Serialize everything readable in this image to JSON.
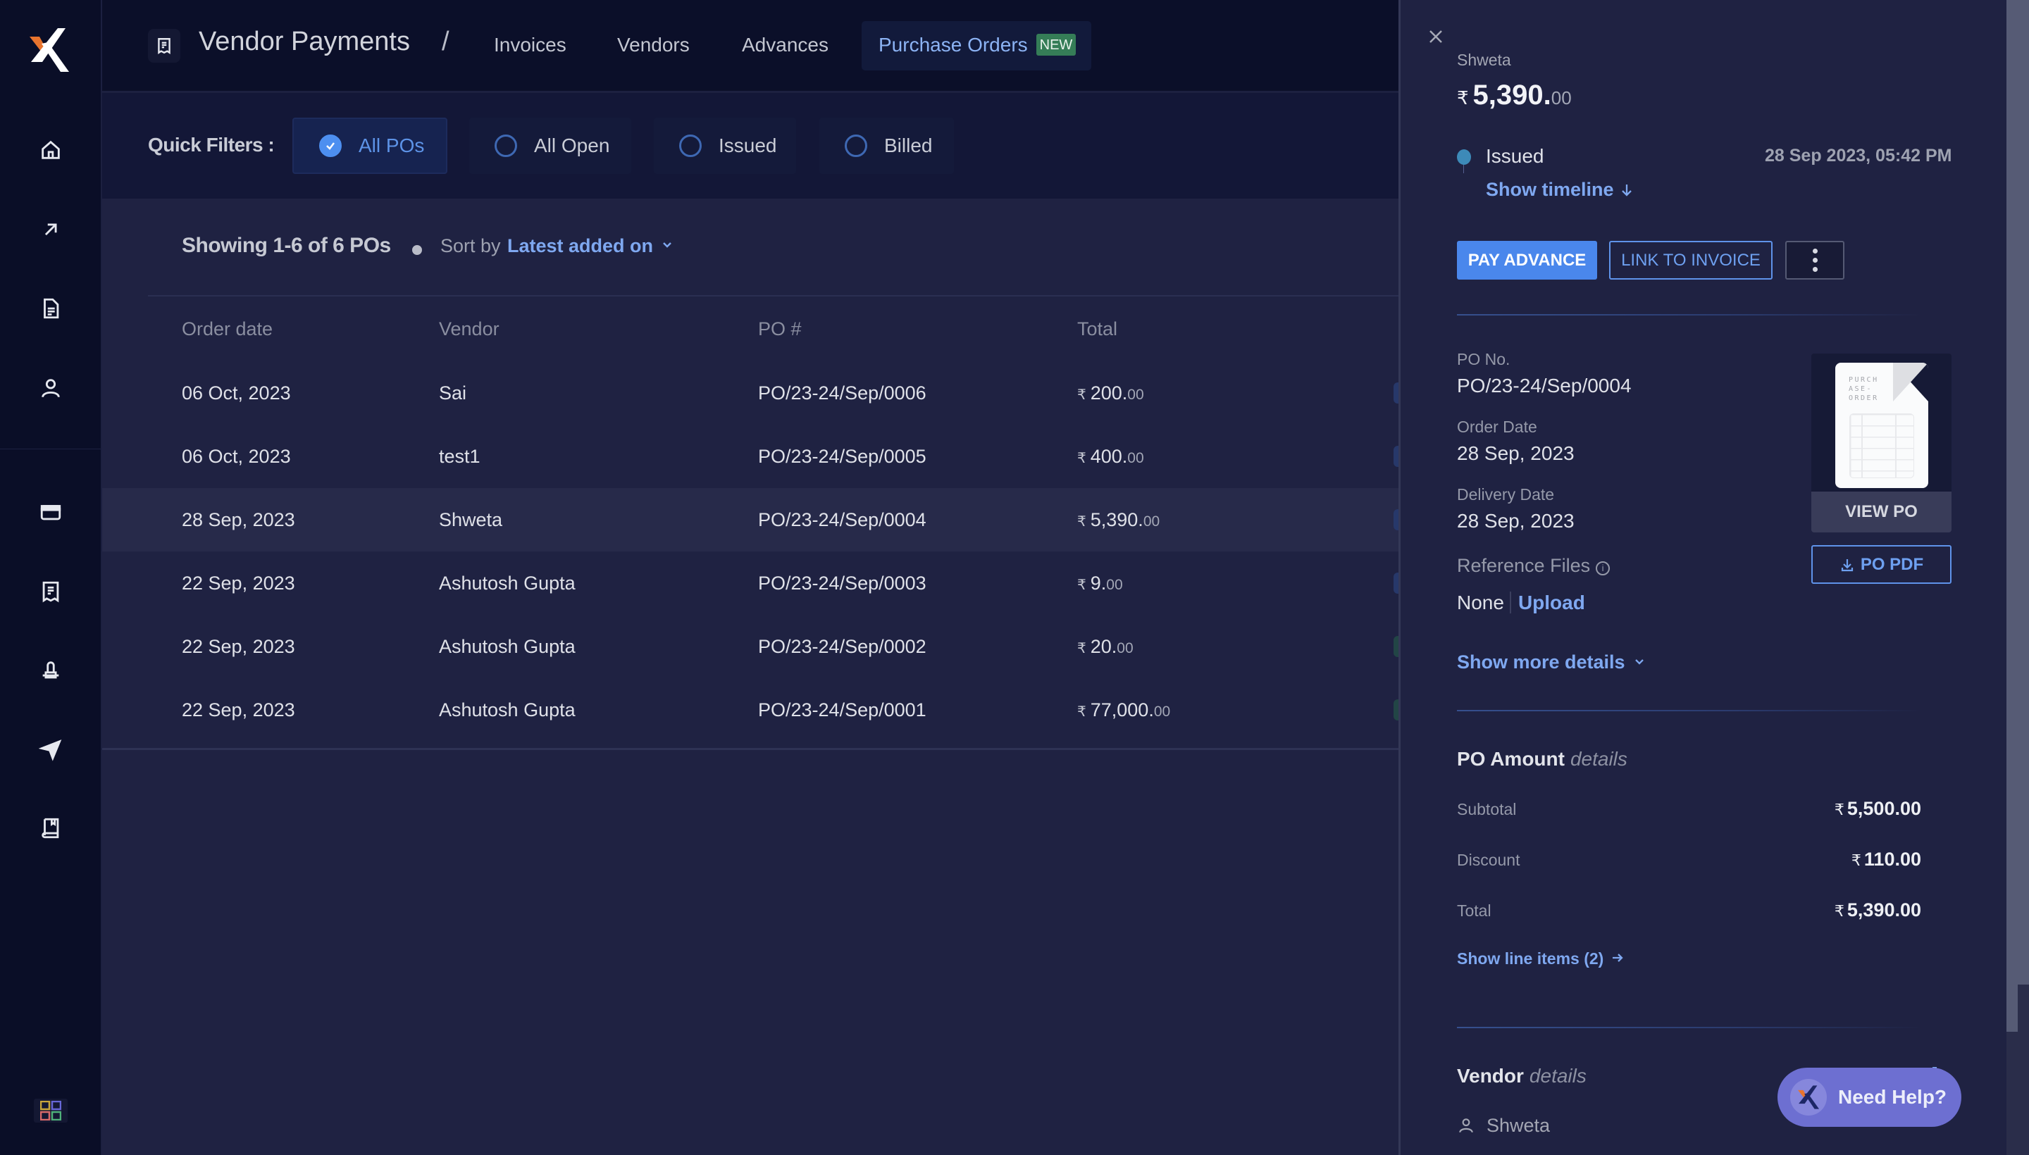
{
  "app": {
    "title": "Vendor Payments",
    "breadcrumb_separator": "/",
    "brand_colors": {
      "accent": "#4a87ec",
      "link": "#7fa8f0",
      "new_badge": "#357d57",
      "logo_orange": "#e8742e",
      "help": "#6d6fd1"
    }
  },
  "sidebar": {
    "logo": "x-logo",
    "items": [
      {
        "icon": "home-icon",
        "label": "Home"
      },
      {
        "icon": "arrow-up-right-icon",
        "label": "Payments"
      },
      {
        "icon": "document-icon",
        "label": "Documents"
      },
      {
        "icon": "user-icon",
        "label": "Contacts"
      },
      {
        "icon": "credit-card-icon",
        "label": "Cards"
      },
      {
        "icon": "receipt-icon",
        "label": "Vendor Payments"
      },
      {
        "icon": "stamp-icon",
        "label": "Approvals"
      },
      {
        "icon": "send-icon",
        "label": "Transfers"
      },
      {
        "icon": "book-icon",
        "label": "Ledger"
      }
    ],
    "apps_icon": "apps-grid-icon"
  },
  "nav": {
    "tabs": [
      {
        "label": "Invoices",
        "active": false
      },
      {
        "label": "Vendors",
        "active": false
      },
      {
        "label": "Advances",
        "active": false
      },
      {
        "label": "Purchase Orders",
        "active": true,
        "badge": "NEW"
      }
    ]
  },
  "filters": {
    "label": "Quick Filters :",
    "options": [
      {
        "label": "All POs",
        "selected": true
      },
      {
        "label": "All Open",
        "selected": false
      },
      {
        "label": "Issued",
        "selected": false
      },
      {
        "label": "Billed",
        "selected": false
      }
    ]
  },
  "list": {
    "summary": "Showing 1-6 of 6 POs",
    "sort_label": "Sort by",
    "sort_value": "Latest added on",
    "columns": [
      "Order date",
      "Vendor",
      "PO #",
      "Total"
    ],
    "currency": "₹",
    "rows": [
      {
        "date": "06 Oct, 2023",
        "vendor": "Sai",
        "po": "PO/23-24/Sep/0006",
        "total": "200.",
        "cents": "00",
        "selected": false
      },
      {
        "date": "06 Oct, 2023",
        "vendor": "test1",
        "po": "PO/23-24/Sep/0005",
        "total": "400.",
        "cents": "00",
        "selected": false
      },
      {
        "date": "28 Sep, 2023",
        "vendor": "Shweta",
        "po": "PO/23-24/Sep/0004",
        "total": "5,390.",
        "cents": "00",
        "selected": true
      },
      {
        "date": "22 Sep, 2023",
        "vendor": "Ashutosh Gupta",
        "po": "PO/23-24/Sep/0003",
        "total": "9.",
        "cents": "00",
        "selected": false
      },
      {
        "date": "22 Sep, 2023",
        "vendor": "Ashutosh Gupta",
        "po": "PO/23-24/Sep/0002",
        "total": "20.",
        "cents": "00",
        "selected": false
      },
      {
        "date": "22 Sep, 2023",
        "vendor": "Ashutosh Gupta",
        "po": "PO/23-24/Sep/0001",
        "total": "77,000.",
        "cents": "00",
        "selected": false
      }
    ]
  },
  "panel": {
    "vendor": "Shweta",
    "currency": "₹",
    "amount": "5,390.",
    "amount_cents": "00",
    "status": "Issued",
    "status_time": "28 Sep 2023, 05:42 PM",
    "show_timeline": "Show timeline",
    "buttons": {
      "pay_advance": "PAY ADVANCE",
      "link_invoice": "LINK TO INVOICE"
    },
    "fields": {
      "po_no_label": "PO No.",
      "po_no": "PO/23-24/Sep/0004",
      "order_date_label": "Order Date",
      "order_date": "28 Sep, 2023",
      "delivery_date_label": "Delivery Date",
      "delivery_date": "28 Sep, 2023",
      "ref_files_label": "Reference Files",
      "ref_files_value": "None",
      "upload": "Upload"
    },
    "doc_thumb_text": "PURCH ASE- ORDER",
    "view_po": "VIEW PO",
    "po_pdf": "PO PDF",
    "show_more": "Show more details",
    "amount_section": {
      "title": "PO Amount",
      "title_suffix": "details",
      "rows": [
        {
          "label": "Subtotal",
          "value": "5,500.00"
        },
        {
          "label": "Discount",
          "value": "110.00"
        },
        {
          "label": "Total",
          "value": "5,390.00"
        }
      ],
      "line_items": "Show line items (2)"
    },
    "vendor_section": {
      "title": "Vendor",
      "title_suffix": "details",
      "name": "Shweta"
    }
  },
  "help": {
    "label": "Need Help?"
  }
}
